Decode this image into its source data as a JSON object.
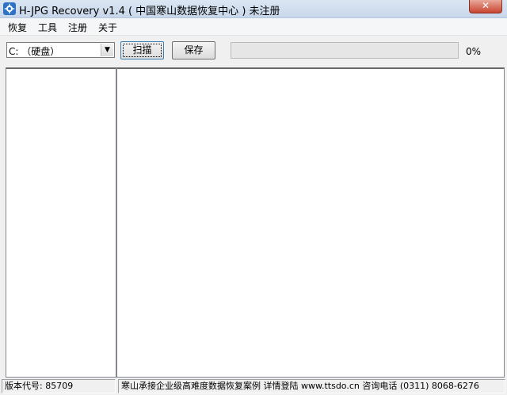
{
  "window": {
    "title": "H-JPG Recovery v1.4 ( 中国寒山数据恢复中心 ) 未注册",
    "close_label": "✕"
  },
  "menu": {
    "items": [
      "恢复",
      "工具",
      "注册",
      "关于"
    ]
  },
  "toolbar": {
    "drive_selected": "C: （硬盘）",
    "drive_arrow": "▼",
    "scan_label": "扫描",
    "save_label": "保存",
    "progress_text": "0%",
    "progress_value": 0
  },
  "statusbar": {
    "version": "版本代号: 85709",
    "ad": "寒山承接企业级高难度数据恢复案例 详情登陆 www.ttsdo.cn 咨询电话 (0311) 8068-6276"
  },
  "icons": {
    "app": "app-icon",
    "close": "close-icon",
    "dropdown": "chevron-down-icon"
  },
  "colors": {
    "progress_fill": "#06b025",
    "close_button": "#c8442f",
    "app_icon": "#2e72c4"
  }
}
